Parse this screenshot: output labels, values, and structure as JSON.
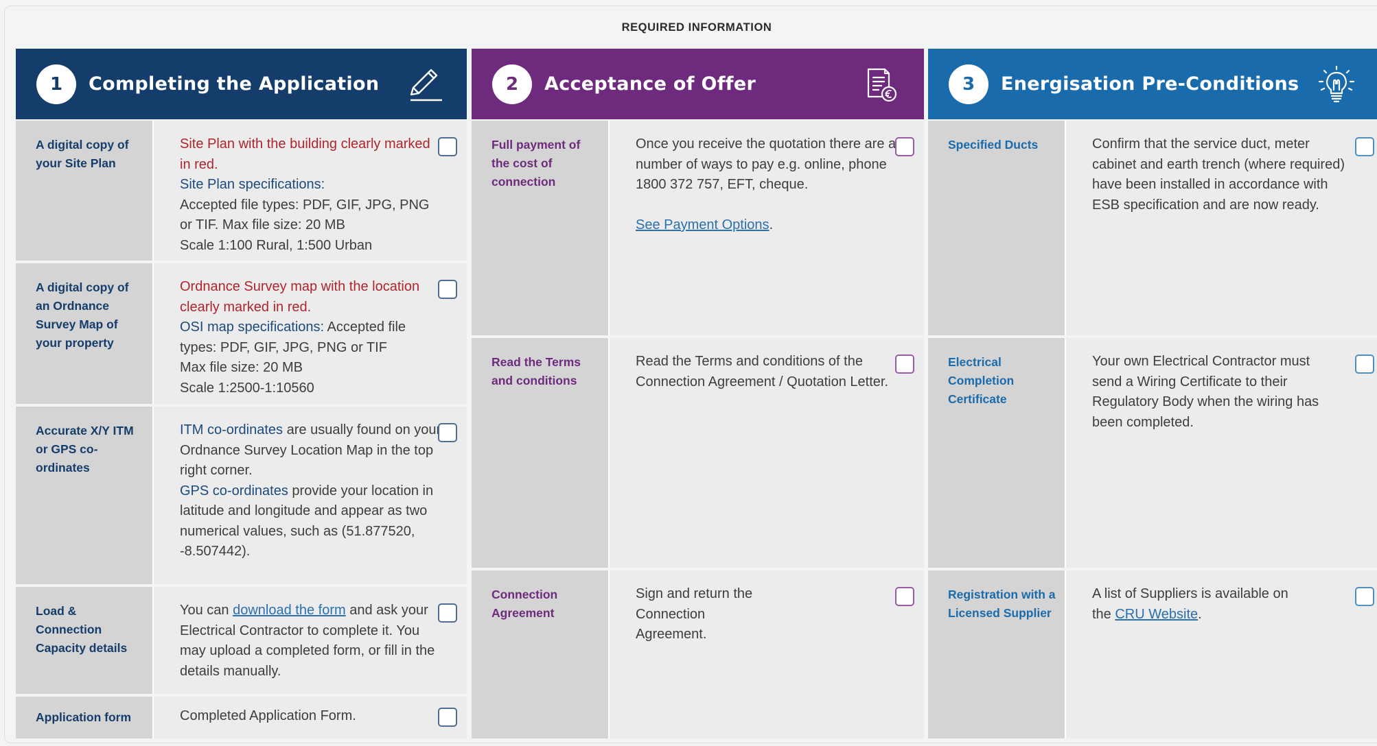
{
  "title": "REQUIRED INFORMATION",
  "colors": {
    "step1": "#153d6b",
    "step2": "#6e2b7d",
    "step3": "#1a6bab",
    "accent_red": "#b0242c"
  },
  "columns": [
    {
      "number": "1",
      "title": "Completing the Application",
      "icon": "pencil-icon",
      "rows": [
        {
          "label": "A digital copy of your Site Plan",
          "lines": {
            "l1": "Site Plan with the building clearly marked in red.",
            "l2": "Site Plan specifications:",
            "l3": "Accepted file types: PDF, GIF, JPG, PNG or TIF. Max file size: 20 MB",
            "l4": "Scale 1:100 Rural, 1:500 Urban"
          }
        },
        {
          "label": "A digital copy of an Ordnance Survey Map of your property",
          "lines": {
            "l1": "Ordnance Survey map with the location clearly marked in red.",
            "l2": "OSI map specifications:",
            "l3": " Accepted file types: PDF, GIF, JPG, PNG or TIF",
            "l4": "Max file size: 20 MB",
            "l5": "Scale 1:2500-1:10560"
          }
        },
        {
          "label": "Accurate X/Y ITM or GPS co-ordinates",
          "lines": {
            "l1": "ITM co-ordinates",
            "l2": " are usually found on your Ordnance Survey Location Map in the top right corner.",
            "l3": "GPS co-ordinates",
            "l4": " provide your location in latitude and longitude and appear as two numerical values, such as (51.877520, -8.507442)."
          }
        },
        {
          "label": "Load & Connection Capacity details",
          "lines": {
            "l1": "You can ",
            "link": "download the form",
            "l2": " and ask your Electrical Contractor to complete it. You may upload a completed form, or fill in the details manually."
          }
        },
        {
          "label": "Application form",
          "lines": {
            "l1": "Completed Application Form."
          }
        }
      ]
    },
    {
      "number": "2",
      "title": "Acceptance of Offer",
      "icon": "document-euro-icon",
      "rows": [
        {
          "label": "Full payment of the cost of connection",
          "lines": {
            "l1": "Once you receive the quotation there are a number of ways to pay e.g. online, phone 1800 372 757, EFT, cheque.",
            "link": "See Payment Options",
            "l2": "."
          }
        },
        {
          "label": "Read the Terms and conditions",
          "lines": {
            "l1": "Read the Terms and conditions of the Connection Agreement / Quotation Letter."
          }
        },
        {
          "label": "Connection Agreement",
          "lines": {
            "l1": "Sign and return the Connection Agreement."
          }
        }
      ]
    },
    {
      "number": "3",
      "title": "Energisation Pre-Conditions",
      "icon": "lightbulb-icon",
      "rows": [
        {
          "label": "Specified Ducts",
          "lines": {
            "l1": "Confirm that the service duct, meter cabinet and earth trench (where required) have been installed in accordance with ESB specification and are now ready."
          }
        },
        {
          "label": "Electrical Completion Certificate",
          "lines": {
            "l1": "Your own Electrical Contractor must send a Wiring Certificate to their Regulatory Body when the wiring has been completed."
          }
        },
        {
          "label": "Registration with a Licensed Supplier",
          "lines": {
            "l1": "A list of Suppliers is available on the ",
            "link": "CRU Website",
            "l2": "."
          }
        }
      ]
    }
  ]
}
